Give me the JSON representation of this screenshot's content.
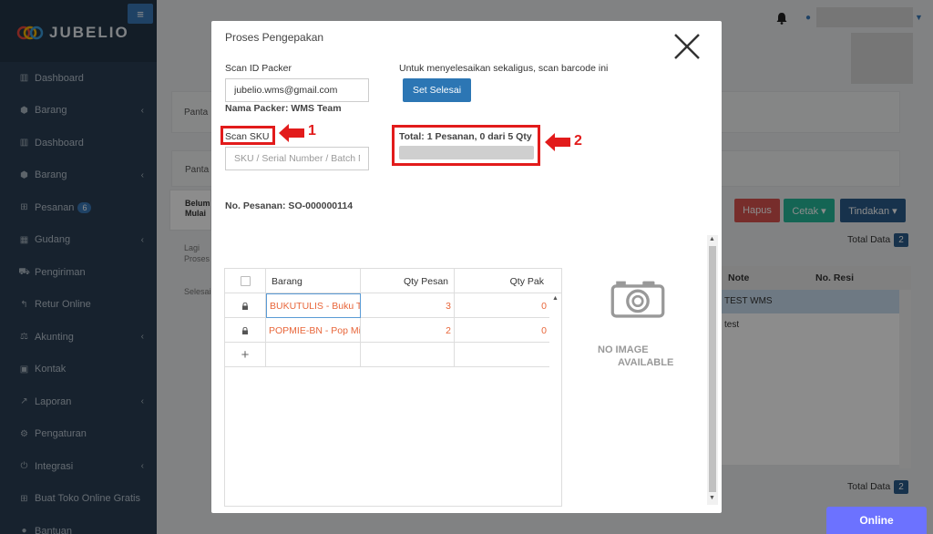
{
  "app": {
    "logo_text": "JUBELIO"
  },
  "sidebar": {
    "items": [
      {
        "label": "Dashboard",
        "icon": "chart-icon",
        "chevron": false
      },
      {
        "label": "Barang",
        "icon": "cubes-icon",
        "chevron": true
      },
      {
        "label": "Dashboard",
        "icon": "chart-icon",
        "chevron": false
      },
      {
        "label": "Barang",
        "icon": "cubes-icon",
        "chevron": true
      },
      {
        "label": "Pesanan",
        "icon": "cart-icon",
        "chevron": false,
        "badge": "6"
      },
      {
        "label": "Gudang",
        "icon": "building-icon",
        "chevron": true
      },
      {
        "label": "Pengiriman",
        "icon": "truck-icon",
        "chevron": false
      },
      {
        "label": "Retur Online",
        "icon": "reply-icon",
        "chevron": false
      },
      {
        "label": "Akunting",
        "icon": "balance-icon",
        "chevron": true
      },
      {
        "label": "Kontak",
        "icon": "contact-icon",
        "chevron": false
      },
      {
        "label": "Laporan",
        "icon": "line-chart-icon",
        "chevron": true
      },
      {
        "label": "Pengaturan",
        "icon": "gears-icon",
        "chevron": false
      },
      {
        "label": "Integrasi",
        "icon": "plug-icon",
        "chevron": true
      },
      {
        "label": "Buat Toko Online Gratis",
        "icon": "cart-icon",
        "chevron": false
      },
      {
        "label": "Bantuan",
        "icon": "help-icon",
        "chevron": false
      }
    ]
  },
  "background": {
    "tab1": "Panta",
    "tab2": "Panta",
    "belum_mulai": "Belum Mulai",
    "lagi_proses": "Lagi Proses",
    "selesai": "Selesai",
    "btn_hapus": "Hapus",
    "btn_cetak": "Cetak ▾",
    "btn_tindakan": "Tindakan ▾",
    "total_data_label": "Total Data",
    "total_data_value": "2",
    "col_note": "Note",
    "col_resi": "No. Resi",
    "rows": [
      {
        "note": "TEST WMS"
      },
      {
        "note": "test"
      }
    ]
  },
  "modal": {
    "title": "Proses Pengepakan",
    "scan_packer_label": "Scan ID Packer",
    "scan_packer_value": "jubelio.wms@gmail.com",
    "packer_name": "Nama Packer: WMS Team",
    "finish_hint": "Untuk menyelesaikan sekaligus, scan barcode ini",
    "finish_button": "Set Selesai",
    "scan_sku_label": "Scan SKU",
    "scan_sku_placeholder": "SKU / Serial Number / Batch No",
    "total_text": "Total: 1 Pesanan, 0 dari 5 Qty",
    "progress_fraction": 0,
    "order_number": "No. Pesanan: SO-000000114",
    "table": {
      "headers": {
        "item": "Barang",
        "qty_order": "Qty Pesan",
        "qty_pack": "Qty Pak"
      },
      "rows": [
        {
          "item": "BUKUTULIS - Buku Tulis",
          "qty_order": "3",
          "qty_pack": "0"
        },
        {
          "item": "POPMIE-BN - Pop Mie",
          "qty_order": "2",
          "qty_pack": "0"
        }
      ],
      "add_symbol": "+"
    },
    "no_image_line1": "NO IMAGE",
    "no_image_line2": "AVAILABLE"
  },
  "annotations": {
    "one": "1",
    "two": "2"
  },
  "online_button": "Online",
  "colors": {
    "accent": "#2c76b4",
    "annotation": "#e21b1b",
    "orange_text": "#e8663a",
    "sidebar": "#2a3f54"
  }
}
